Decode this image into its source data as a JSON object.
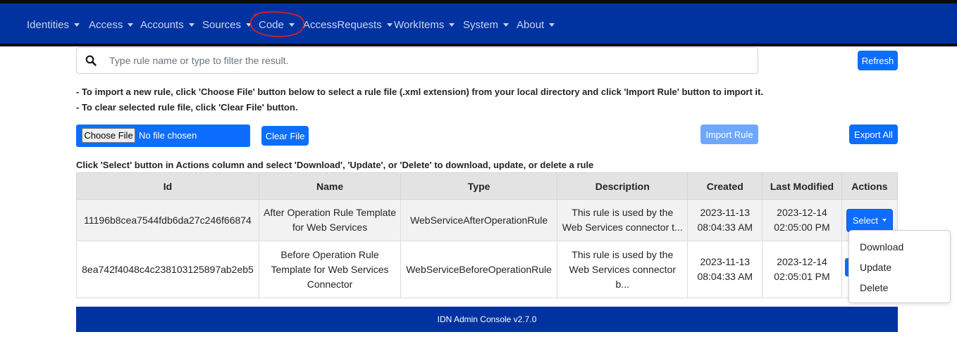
{
  "nav": {
    "items": [
      {
        "label": "Identities"
      },
      {
        "label": "Access"
      },
      {
        "label": "Accounts"
      },
      {
        "label": "Sources"
      },
      {
        "label": "Code"
      },
      {
        "label": "AccessRequests"
      },
      {
        "label": "WorkItems"
      },
      {
        "label": "System"
      },
      {
        "label": "About"
      }
    ],
    "annotation_color": "#e8211c"
  },
  "search": {
    "placeholder": "Type rule name or type to filter the result.",
    "value": ""
  },
  "buttons": {
    "refresh": "Refresh",
    "clear_file": "Clear File",
    "import_rule": "Import Rule",
    "export_all": "Export All"
  },
  "instructions": {
    "line1": "- To import a new rule, click 'Choose File' button below to select a rule file (.xml extension) from your local directory and click 'Import Rule' button to import it.",
    "line2": "- To clear selected rule file, click 'Clear File' button.",
    "table_hint": "Click 'Select' button in Actions column and select 'Download', 'Update', or 'Delete' to download, update, or delete a rule"
  },
  "file_input": {
    "choose_label": "Choose File",
    "status": "No file chosen"
  },
  "table": {
    "headers": [
      "Id",
      "Name",
      "Type",
      "Description",
      "Created",
      "Last Modified",
      "Actions"
    ],
    "rows": [
      {
        "id": "11196b8cea7544fdb6da27c246f66874",
        "name": "After Operation Rule Template for Web Services",
        "type": "WebServiceAfterOperationRule",
        "description": "This rule is used by the Web Services connector t...",
        "created": "2023-11-13 08:04:33 AM",
        "modified": "2023-12-14 02:05:00 PM",
        "action": "Select"
      },
      {
        "id": "8ea742f4048c4c238103125897ab2eb5",
        "name": "Before Operation Rule Template for Web Services Connector",
        "type": "WebServiceBeforeOperationRule",
        "description": "This rule is used by the Web Services connector b...",
        "created": "2023-11-13 08:04:33 AM",
        "modified": "2023-12-14 02:05:01 PM",
        "action": ""
      }
    ]
  },
  "dropdown": {
    "items": [
      "Download",
      "Update",
      "Delete"
    ]
  },
  "footer": {
    "text": "IDN Admin Console v2.7.0"
  },
  "colors": {
    "navbar": "#0032a0",
    "primary": "#0d6efd",
    "primary_disabled": "#6ea8fe"
  }
}
